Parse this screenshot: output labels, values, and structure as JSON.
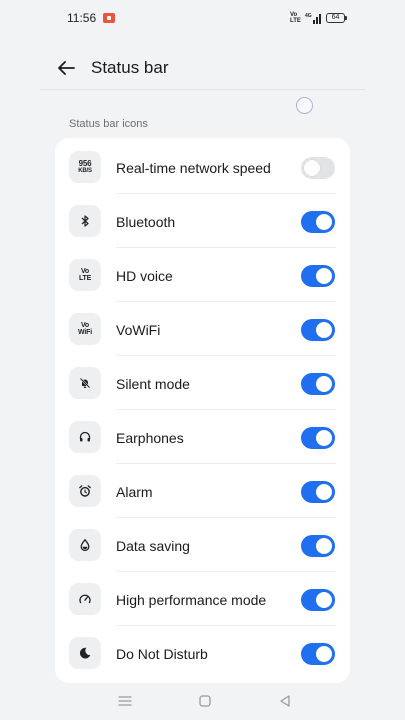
{
  "status_bar": {
    "time": "11:56",
    "volte_top": "Vo",
    "volte_bottom": "LTE",
    "battery": "64"
  },
  "header": {
    "title": "Status bar"
  },
  "section_label": "Status bar icons",
  "colors": {
    "accent": "#1f6ff0",
    "toggle_off": "#e2e3e5",
    "background": "#f1f3f4"
  },
  "items": [
    {
      "label": "Real-time network speed",
      "icon": "network-speed-icon",
      "icon_text_top": "956",
      "icon_text_bottom": "KB/S",
      "enabled": false
    },
    {
      "label": "Bluetooth",
      "icon": "bluetooth-icon",
      "enabled": true
    },
    {
      "label": "HD voice",
      "icon": "hd-voice-icon",
      "icon_text_top": "Vo",
      "icon_text_bottom": "LTE",
      "enabled": true
    },
    {
      "label": "VoWiFi",
      "icon": "vowifi-icon",
      "icon_text_top": "Vo",
      "icon_text_bottom": "WiFi",
      "enabled": true
    },
    {
      "label": "Silent mode",
      "icon": "silent-mode-icon",
      "enabled": true
    },
    {
      "label": "Earphones",
      "icon": "earphones-icon",
      "enabled": true
    },
    {
      "label": "Alarm",
      "icon": "alarm-icon",
      "enabled": true
    },
    {
      "label": "Data saving",
      "icon": "data-saving-icon",
      "enabled": true
    },
    {
      "label": "High performance mode",
      "icon": "high-performance-icon",
      "enabled": true
    },
    {
      "label": "Do Not Disturb",
      "icon": "do-not-disturb-icon",
      "enabled": true
    }
  ]
}
